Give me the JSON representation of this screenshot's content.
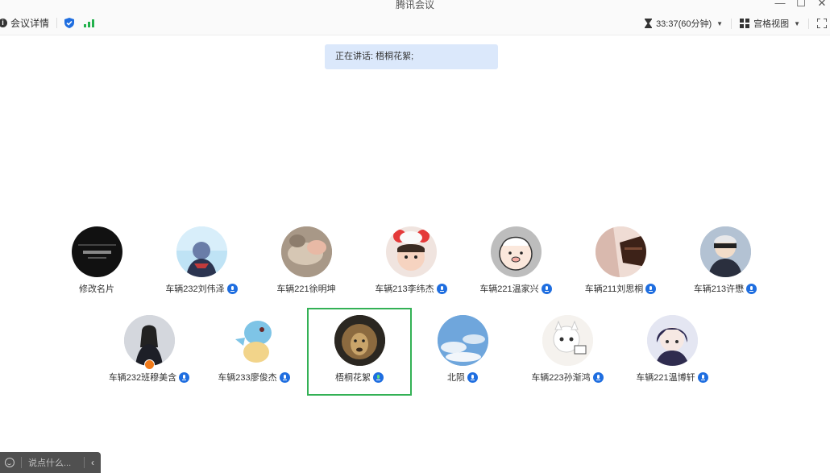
{
  "window": {
    "title": "腾讯会议"
  },
  "toolbar": {
    "meeting_details": "会议详情",
    "timer": "33:37(60分钟)",
    "view_mode": "宫格视图"
  },
  "speaking_banner": "正在讲话: 梧桐花絮;",
  "participants": [
    {
      "name": "修改名片",
      "mic": false
    },
    {
      "name": "车辆232刘伟泽",
      "mic": true
    },
    {
      "name": "车辆221徐明坤",
      "mic": false
    },
    {
      "name": "车辆213李纬杰",
      "mic": true
    },
    {
      "name": "车辆221温家兴",
      "mic": true
    },
    {
      "name": "车辆211刘思桐",
      "mic": true
    },
    {
      "name": "车辆213许懋",
      "mic": true
    },
    {
      "name": "车辆232班穆美含",
      "mic": true
    },
    {
      "name": "车辆233廖俊杰",
      "mic": true
    },
    {
      "name": "梧桐花絮",
      "mic": true,
      "speaking": true
    },
    {
      "name": "北陨",
      "mic": true
    },
    {
      "name": "车辆223孙渐鸿",
      "mic": true
    },
    {
      "name": "车辆221温博轩",
      "mic": true
    }
  ],
  "chat": {
    "placeholder": "说点什么..."
  },
  "colors": {
    "active_border": "#33b155",
    "mic_blue": "#1f6ee0",
    "banner_bg": "#dbe8fb",
    "chat_bg": "#505050"
  }
}
